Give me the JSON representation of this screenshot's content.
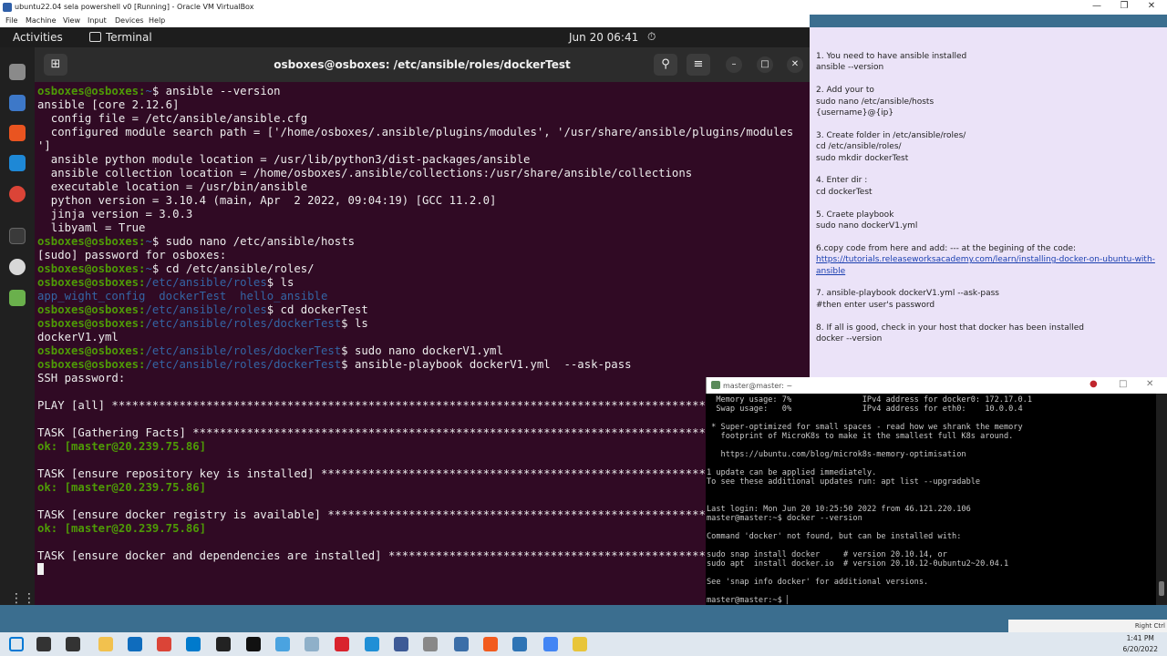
{
  "vbox": {
    "title": "ubuntu22.04 sela powershell v0 [Running] - Oracle VM VirtualBox",
    "menu": [
      "File",
      "Machine",
      "View",
      "Input",
      "Devices",
      "Help"
    ]
  },
  "ubuntu_topbar": {
    "activities": "Activities",
    "app_name": "Terminal",
    "clock": "Jun 20  06:41"
  },
  "terminal": {
    "title": "osboxes@osboxes: /etc/ansible/roles/dockerTest",
    "lines": [
      [
        {
          "t": "osboxes@osboxes:",
          "c": "g"
        },
        {
          "t": "~",
          "c": "b"
        },
        {
          "t": "$ ansible --version"
        }
      ],
      [
        {
          "t": "ansible [core 2.12.6]"
        }
      ],
      [
        {
          "t": "  config file = /etc/ansible/ansible.cfg"
        }
      ],
      [
        {
          "t": "  configured module search path = ['/home/osboxes/.ansible/plugins/modules', '/usr/share/ansible/plugins/modules"
        }
      ],
      [
        {
          "t": "']"
        }
      ],
      [
        {
          "t": "  ansible python module location = /usr/lib/python3/dist-packages/ansible"
        }
      ],
      [
        {
          "t": "  ansible collection location = /home/osboxes/.ansible/collections:/usr/share/ansible/collections"
        }
      ],
      [
        {
          "t": "  executable location = /usr/bin/ansible"
        }
      ],
      [
        {
          "t": "  python version = 3.10.4 (main, Apr  2 2022, 09:04:19) [GCC 11.2.0]"
        }
      ],
      [
        {
          "t": "  jinja version = 3.0.3"
        }
      ],
      [
        {
          "t": "  libyaml = True"
        }
      ],
      [
        {
          "t": "osboxes@osboxes:",
          "c": "g"
        },
        {
          "t": "~",
          "c": "b"
        },
        {
          "t": "$ sudo nano /etc/ansible/hosts"
        }
      ],
      [
        {
          "t": "[sudo] password for osboxes:"
        }
      ],
      [
        {
          "t": "osboxes@osboxes:",
          "c": "g"
        },
        {
          "t": "~",
          "c": "b"
        },
        {
          "t": "$ cd /etc/ansible/roles/"
        }
      ],
      [
        {
          "t": "osboxes@osboxes:",
          "c": "g"
        },
        {
          "t": "/etc/ansible/roles",
          "c": "b"
        },
        {
          "t": "$ ls"
        }
      ],
      [
        {
          "t": "app_wight_config  dockerTest  hello_ansible",
          "c": "b"
        }
      ],
      [
        {
          "t": "osboxes@osboxes:",
          "c": "g"
        },
        {
          "t": "/etc/ansible/roles",
          "c": "b"
        },
        {
          "t": "$ cd dockerTest"
        }
      ],
      [
        {
          "t": "osboxes@osboxes:",
          "c": "g"
        },
        {
          "t": "/etc/ansible/roles/dockerTest",
          "c": "b"
        },
        {
          "t": "$ ls"
        }
      ],
      [
        {
          "t": "dockerV1.yml"
        }
      ],
      [
        {
          "t": "osboxes@osboxes:",
          "c": "g"
        },
        {
          "t": "/etc/ansible/roles/dockerTest",
          "c": "b"
        },
        {
          "t": "$ sudo nano dockerV1.yml"
        }
      ],
      [
        {
          "t": "osboxes@osboxes:",
          "c": "g"
        },
        {
          "t": "/etc/ansible/roles/dockerTest",
          "c": "b"
        },
        {
          "t": "$ ansible-playbook dockerV1.yml  --ask-pass"
        }
      ],
      [
        {
          "t": "SSH password:"
        }
      ],
      [
        {
          "t": ""
        }
      ],
      [
        {
          "t": "PLAY [all] ****************************************************************************************************"
        }
      ],
      [
        {
          "t": ""
        }
      ],
      [
        {
          "t": "TASK [Gathering Facts] ****************************************************************************************"
        }
      ],
      [
        {
          "t": "ok: [master@20.239.75.86]",
          "c": "g"
        }
      ],
      [
        {
          "t": ""
        }
      ],
      [
        {
          "t": "TASK [ensure repository key is installed] *********************************************************************"
        }
      ],
      [
        {
          "t": "ok: [master@20.239.75.86]",
          "c": "g"
        }
      ],
      [
        {
          "t": ""
        }
      ],
      [
        {
          "t": "TASK [ensure docker registry is available] ********************************************************************"
        }
      ],
      [
        {
          "t": "ok: [master@20.239.75.86]",
          "c": "g"
        }
      ],
      [
        {
          "t": ""
        }
      ],
      [
        {
          "t": "TASK [ensure docker and dependencies are installed] ***********************************************************"
        }
      ],
      [
        {
          "t": "",
          "cursor": true
        }
      ]
    ]
  },
  "notes": {
    "items": [
      [
        "1. You need to have ansible installed",
        "ansible --version"
      ],
      [
        "2. Add your to",
        "sudo nano /etc/ansible/hosts",
        "{username}@{ip}"
      ],
      [
        "3. Create folder in /etc/ansible/roles/",
        "cd /etc/ansible/roles/",
        "sudo mkdir dockerTest"
      ],
      [
        "4.  Enter dir :",
        "cd dockerTest"
      ],
      [
        "5. Craete playbook",
        "sudo nano dockerV1.yml"
      ],
      [
        "6.copy code from here and add: --- at the begining of the code:",
        {
          "link": "https://tutorials.releaseworksacademy.com/learn/installing-docker-on-ubuntu-with-ansible"
        }
      ],
      [
        "7. ansible-playbook dockerV1.yml  --ask-pass",
        "#then enter user's password"
      ],
      [
        "8. If all is good, check in your host that docker has been installed",
        "docker --version"
      ]
    ]
  },
  "ssh": {
    "title": "master@master: ~",
    "lines": [
      "  Memory usage: 7%               IPv4 address for docker0: 172.17.0.1",
      "  Swap usage:   0%               IPv4 address for eth0:    10.0.0.4",
      "",
      " * Super-optimized for small spaces - read how we shrank the memory",
      "   footprint of MicroK8s to make it the smallest full K8s around.",
      "",
      "   https://ubuntu.com/blog/microk8s-memory-optimisation",
      "",
      "1 update can be applied immediately.",
      "To see these additional updates run: apt list --upgradable",
      "",
      "",
      "Last login: Mon Jun 20 10:25:50 2022 from 46.121.220.106",
      "master@master:~$ docker --version",
      "",
      "Command 'docker' not found, but can be installed with:",
      "",
      "sudo snap install docker     # version 20.10.14, or",
      "sudo apt  install docker.io  # version 20.10.12-0ubuntu2~20.04.1",
      "",
      "See 'snap info docker' for additional versions.",
      "",
      "master@master:~$ ▏"
    ]
  },
  "vbox_status": {
    "host_key": "Right Ctrl"
  },
  "taskbar": {
    "time": "1:41 PM",
    "date": "6/20/2022",
    "icons": [
      "windows-icon",
      "search-icon",
      "task-view-icon",
      "file-explorer-icon",
      "mail-icon",
      "chrome-icon",
      "vscode-icon",
      "obs-icon",
      "terminal-icon",
      "azure-icon",
      "notepad-icon",
      "opera-icon",
      "edge-icon",
      "virtualbox-icon",
      "box-icon",
      "network-icon",
      "brave-icon",
      "sourcetree-icon",
      "chrome-alt-icon",
      "sticky-icon"
    ],
    "icon_colors": [
      "#0078d4",
      "#333333",
      "#333333",
      "#f2c14e",
      "#0f6cbd",
      "#db4437",
      "#007acc",
      "#222222",
      "#111111",
      "#4aa3e0",
      "#8fb0c9",
      "#d9232d",
      "#1f8fd6",
      "#3d5a96",
      "#888888",
      "#3b6ea8",
      "#f25b1e",
      "#2e74b5",
      "#4285f4",
      "#e8c53a"
    ]
  }
}
